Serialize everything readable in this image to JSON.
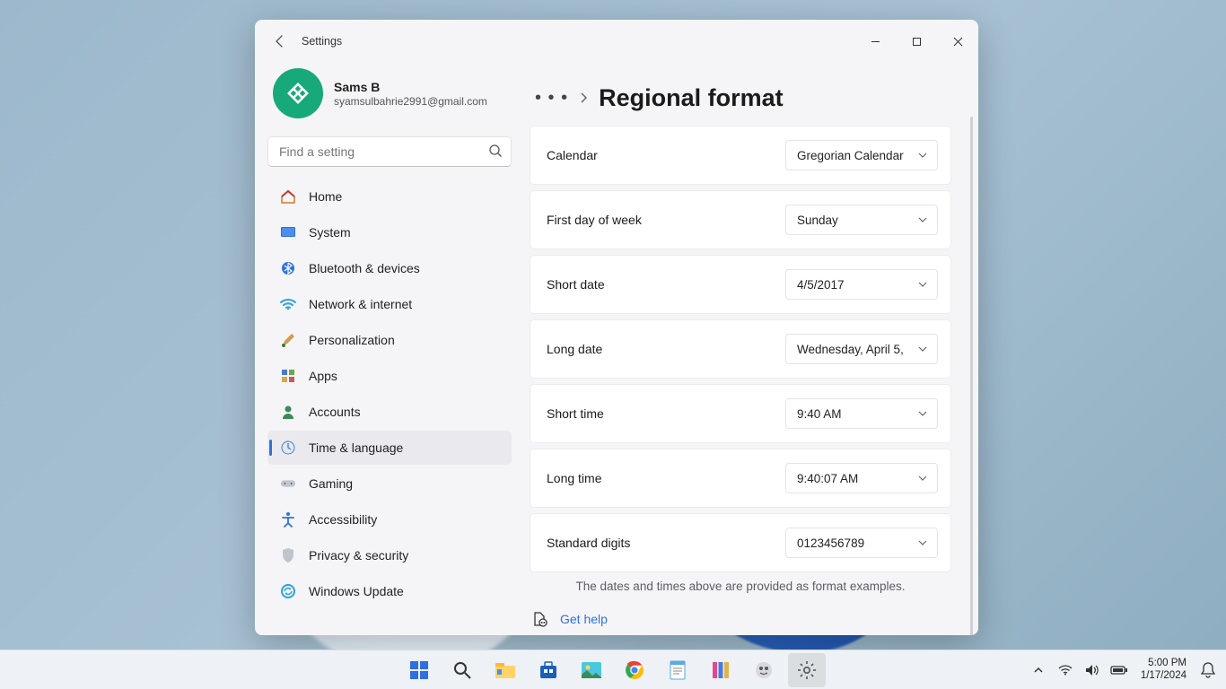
{
  "window": {
    "title": "Settings",
    "controls": {
      "minimize": "–",
      "maximize": "☐",
      "close": "✕"
    }
  },
  "profile": {
    "name": "Sams B",
    "email": "syamsulbahrie2991@gmail.com"
  },
  "search": {
    "placeholder": "Find a setting"
  },
  "nav": {
    "items": [
      {
        "label": "Home"
      },
      {
        "label": "System"
      },
      {
        "label": "Bluetooth & devices"
      },
      {
        "label": "Network & internet"
      },
      {
        "label": "Personalization"
      },
      {
        "label": "Apps"
      },
      {
        "label": "Accounts"
      },
      {
        "label": "Time & language"
      },
      {
        "label": "Gaming"
      },
      {
        "label": "Accessibility"
      },
      {
        "label": "Privacy & security"
      },
      {
        "label": "Windows Update"
      }
    ],
    "active_index": 7
  },
  "page": {
    "title": "Regional format",
    "rows": [
      {
        "label": "Calendar",
        "value": "Gregorian Calendar"
      },
      {
        "label": "First day of week",
        "value": "Sunday"
      },
      {
        "label": "Short date",
        "value": "4/5/2017"
      },
      {
        "label": "Long date",
        "value": "Wednesday, April 5,"
      },
      {
        "label": "Short time",
        "value": "9:40 AM"
      },
      {
        "label": "Long time",
        "value": "9:40:07 AM"
      },
      {
        "label": "Standard digits",
        "value": "0123456789"
      }
    ],
    "hint": "The dates and times above are provided as format examples.",
    "help": "Get help"
  },
  "taskbar": {
    "clock_time": "5:00 PM",
    "clock_date": "1/17/2024"
  }
}
